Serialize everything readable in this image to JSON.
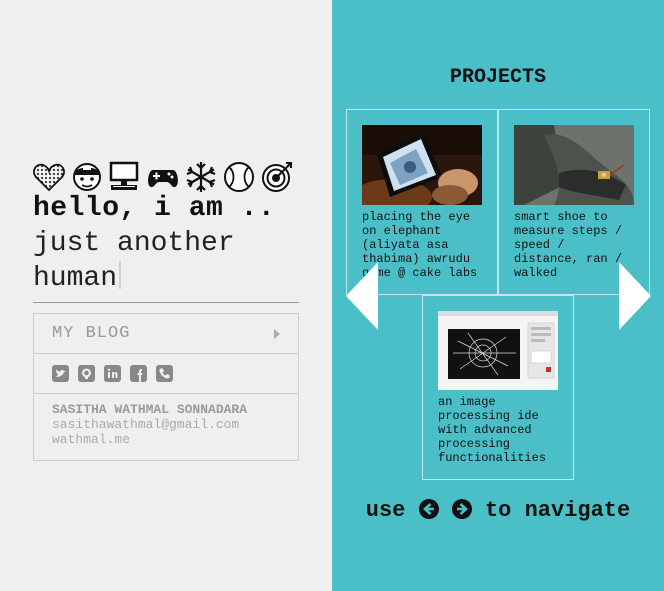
{
  "intro": {
    "greeting": "hello, i am ..",
    "tagline": "just another human"
  },
  "icons": [
    "heart-icon",
    "helmet-face-icon",
    "computer-icon",
    "gamepad-icon",
    "snowflake-icon",
    "baseball-icon",
    "target-icon"
  ],
  "card": {
    "blog_label": "MY BLOG",
    "social_icons": [
      "twitter-icon",
      "github-icon",
      "linkedin-icon",
      "facebook-icon",
      "phone-icon"
    ],
    "name": "SASITHA WATHMAL SONNADARA",
    "email": "sasithawathmal@gmail.com",
    "site": "wathmal.me"
  },
  "projects": {
    "title": "PROJECTS",
    "items": [
      {
        "caption": "placing the eye on elephant (aliyata asa thabima) awrudu game @ cake labs"
      },
      {
        "caption": "smart shoe to measure steps / speed / distance, ran / walked"
      },
      {
        "caption": "an image processing ide with advanced processing functionalities"
      }
    ],
    "nav_before": "use",
    "nav_after": "to navigate"
  },
  "colors": {
    "left_bg": "#efefef",
    "right_bg": "#4bbfc7",
    "text": "#111111",
    "muted": "#999999"
  }
}
